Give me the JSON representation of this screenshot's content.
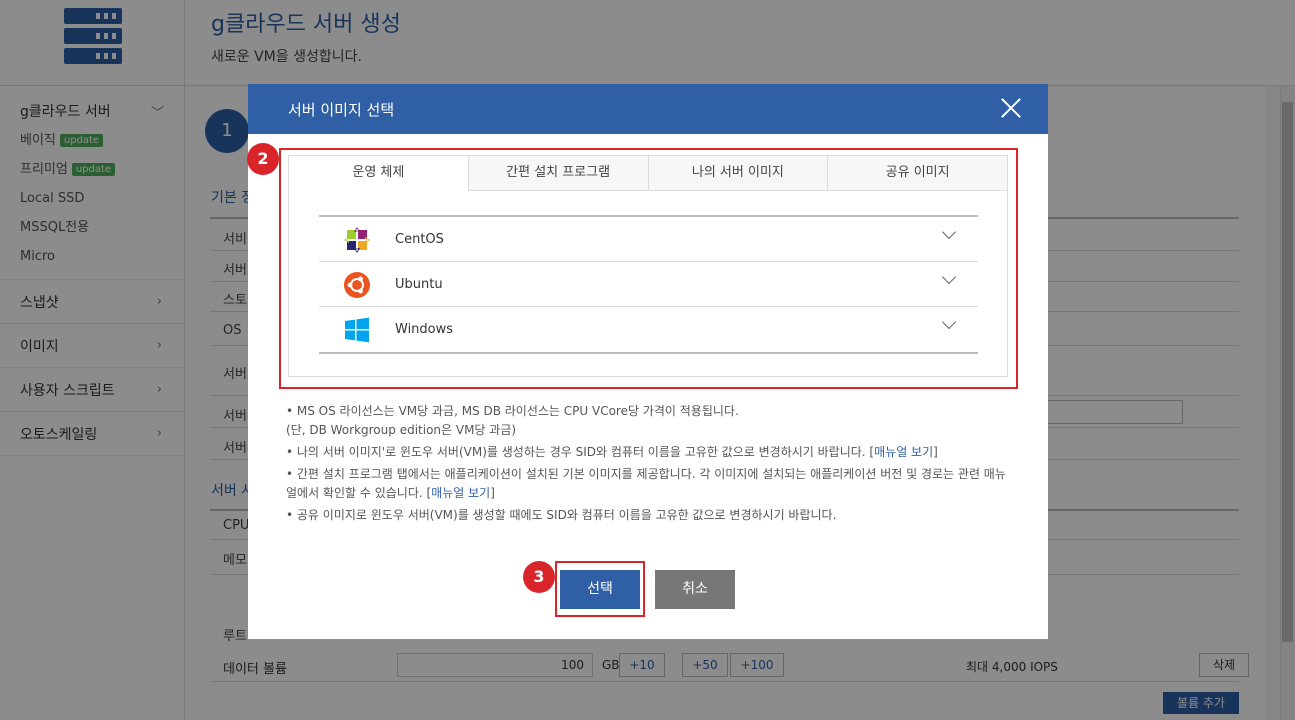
{
  "sidebar": {
    "group_title": "g클라우드 서버",
    "sub_items": [
      {
        "label": "베이직",
        "badge": "update"
      },
      {
        "label": "프리미엄",
        "badge": "update"
      },
      {
        "label": "Local SSD"
      },
      {
        "label": "MSSQL전용"
      },
      {
        "label": "Micro"
      }
    ],
    "items": [
      {
        "label": "스냅샷"
      },
      {
        "label": "이미지"
      },
      {
        "label": "사용자 스크립트"
      },
      {
        "label": "오토스케일링"
      }
    ]
  },
  "page": {
    "title": "g클라우드 서버 생성",
    "subtitle": "새로운 VM을 생성합니다.",
    "step": "1",
    "section1_title": "기본 정",
    "section1_rows": [
      "서비",
      "서버",
      "스토",
      "OS",
      "서버",
      "서버",
      "서버"
    ],
    "section2_title": "서버 사",
    "section2_rows": [
      "CPU",
      "메모"
    ],
    "root_label": "루트",
    "data_volume": {
      "label": "데이터 볼륨",
      "value": "100",
      "unit": "GB",
      "buttons": [
        "+10",
        "+50",
        "+100"
      ],
      "iops": "최대 4,000 IOPS",
      "delete_label": "삭제"
    },
    "add_volume_label": "볼륨 추가"
  },
  "modal": {
    "title": "서버 이미지 선택",
    "tabs": [
      "운영 체제",
      "간편 설치 프로그램",
      "나의 서버 이미지",
      "공유 이미지"
    ],
    "os_list": [
      {
        "name": "CentOS",
        "icon": "centos-icon"
      },
      {
        "name": "Ubuntu",
        "icon": "ubuntu-icon"
      },
      {
        "name": "Windows",
        "icon": "windows-icon"
      }
    ],
    "notes": {
      "n1": "• MS OS 라이선스는 VM당 과금, MS DB 라이선스는 CPU VCore당 가격이 적용됩니다.",
      "n1b": "(단, DB Workgroup edition은 VM당 과금)",
      "n2": "• 나의 서버 이미지'로 윈도우 서버(VM)를 생성하는 경우 SID와 컴퓨터 이름을 고유한 값으로 변경하시기 바랍니다. [",
      "n2_link": "매뉴얼 보기",
      "n3": "• 간편 설치 프로그램 탭에서는 애플리케이션이 설치된 기본 이미지를 제공합니다. 각 이미지에 설치되는 애플리케이션 버전 및 경로는 관련 매뉴얼에서 확인할 수 있습니다. [",
      "n3_link": "매뉴얼 보기",
      "n4": "• 공유 이미지로 윈도우 서버(VM)를 생성할 때에도 SID와 컴퓨터 이름을 고유한 값으로 변경하시기 바랍니다.",
      "close_bracket": "]"
    },
    "select_label": "선택",
    "cancel_label": "취소"
  },
  "annotations": {
    "badge2": "2",
    "badge3": "3"
  },
  "colors": {
    "brand": "#2f5fa4",
    "highlight": "#d9252a",
    "badge_green": "#4fae5a"
  }
}
